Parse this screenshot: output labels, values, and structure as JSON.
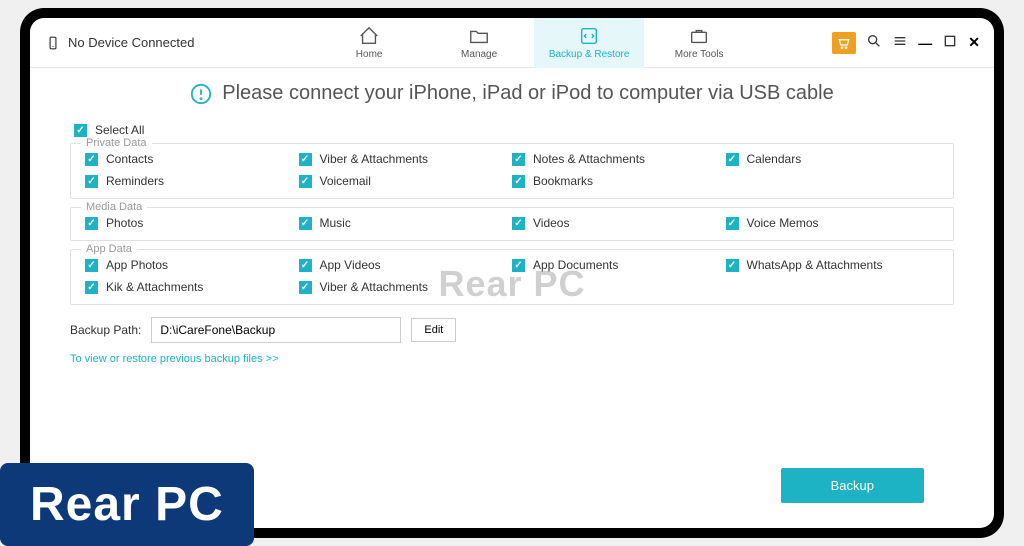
{
  "device_status": "No Device Connected",
  "nav": {
    "home": "Home",
    "manage": "Manage",
    "backup_restore": "Backup & Restore",
    "more_tools": "More Tools"
  },
  "connect_message": "Please connect your iPhone, iPad or iPod to computer via USB cable",
  "select_all": "Select All",
  "sections": {
    "private": {
      "title": "Private Data",
      "items": [
        "Contacts",
        "Viber & Attachments",
        "Notes & Attachments",
        "Calendars",
        "Reminders",
        "Voicemail",
        "Bookmarks"
      ]
    },
    "media": {
      "title": "Media Data",
      "items": [
        "Photos",
        "Music",
        "Videos",
        "Voice Memos"
      ]
    },
    "app": {
      "title": "App Data",
      "items": [
        "App Photos",
        "App Videos",
        "App Documents",
        "WhatsApp & Attachments",
        "Kik & Attachments",
        "Viber & Attachments"
      ]
    }
  },
  "backup_path_label": "Backup Path:",
  "backup_path_value": "D:\\iCareFone\\Backup",
  "edit_button": "Edit",
  "restore_link": "To view or restore previous backup files >>",
  "backup_button": "Backup",
  "watermark": "Rear PC",
  "overlay_badge": "Rear PC"
}
